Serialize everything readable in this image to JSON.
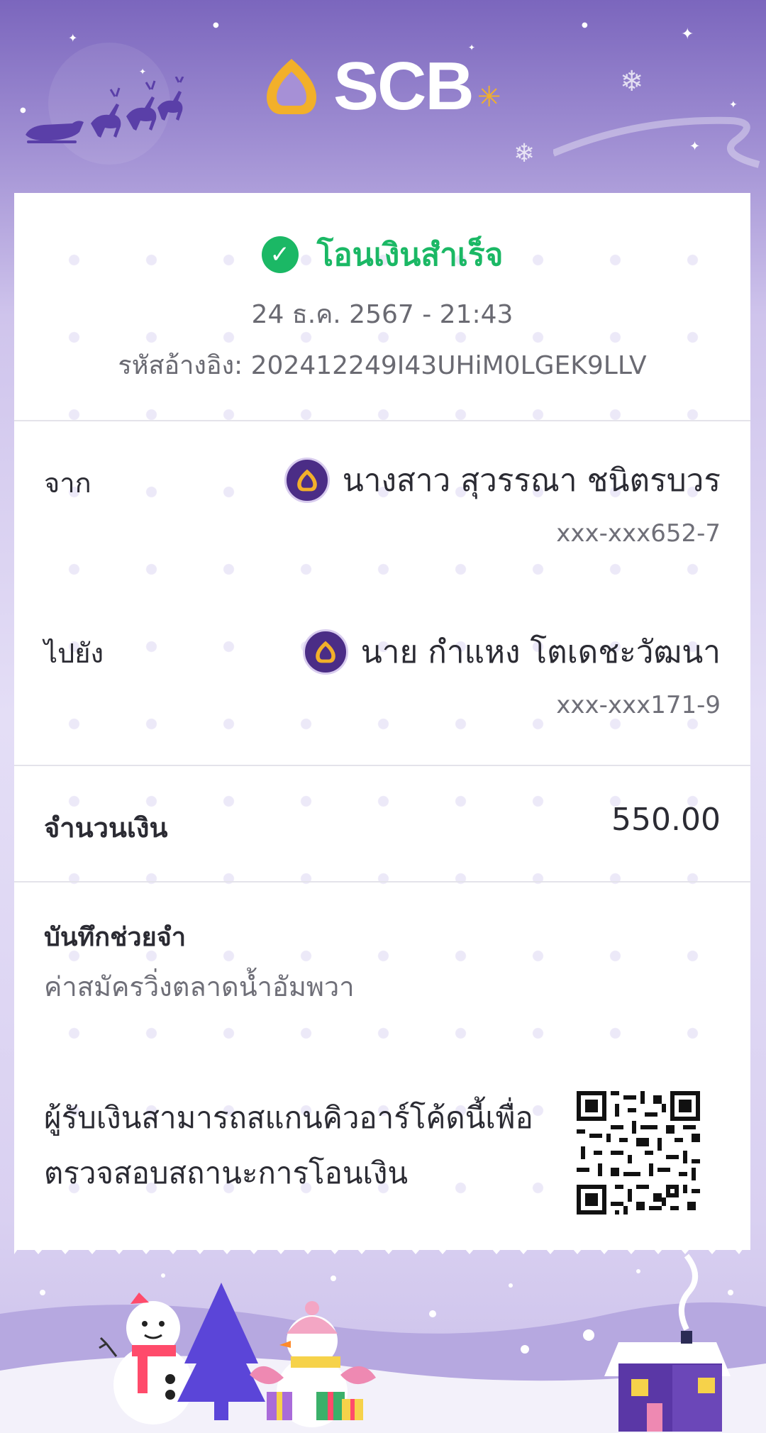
{
  "brand": {
    "name": "SCB",
    "accent": "#4b2d86",
    "gold": "#f2b02a"
  },
  "status": {
    "text": "โอนเงินสำเร็จ",
    "color": "#1bb865",
    "icon": "check-circle-icon"
  },
  "datetime": "24 ธ.ค. 2567 - 21:43",
  "reference": "รหัสอ้างอิง: 202412249I43UHiM0LGEK9LLV",
  "from": {
    "label": "จาก",
    "name": "นางสาว สุวรรณา ชนิตรบวร",
    "account": "xxx-xxx652-7",
    "bank_icon": "scb-bank-icon"
  },
  "to": {
    "label": "ไปยัง",
    "name": "นาย กำแหง โตเดชะวัฒนา",
    "account": "xxx-xxx171-9",
    "bank_icon": "scb-bank-icon"
  },
  "amount": {
    "label": "จำนวนเงิน",
    "value": "550.00"
  },
  "memo": {
    "label": "บันทึกช่วยจำ",
    "value": "ค่าสมัครวิ่งตลาดน้ำอัมพวา"
  },
  "qr": {
    "line1": "ผู้รับเงินสามารถสแกนคิวอาร์โค้ดนี้เพื่อ",
    "line2": "ตรวจสอบสถานะการโอนเงิน",
    "icon": "qr-code-icon"
  }
}
